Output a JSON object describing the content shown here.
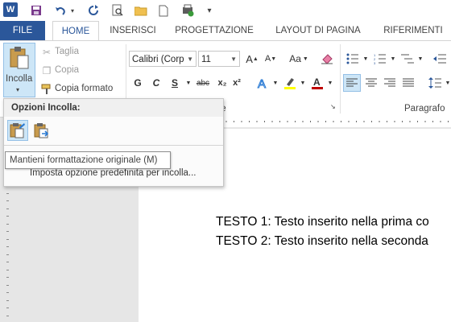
{
  "qat": {
    "icons": [
      "word-logo-icon",
      "save-icon",
      "undo-icon",
      "redo-icon",
      "print-preview-icon",
      "open-folder-icon",
      "new-document-icon",
      "send-icon",
      "customize-icon"
    ],
    "word_logo": "W"
  },
  "tabs": [
    {
      "label": "FILE"
    },
    {
      "label": "HOME"
    },
    {
      "label": "INSERISCI"
    },
    {
      "label": "PROGETTAZIONE"
    },
    {
      "label": "LAYOUT DI PAGINA"
    },
    {
      "label": "RIFERIMENTI"
    }
  ],
  "clipboard": {
    "paste_label": "Incolla",
    "cut_label": "Taglia",
    "copy_label": "Copia",
    "format_painter_label": "Copia formato"
  },
  "font": {
    "name": "Calibri (Corp",
    "size": "11",
    "group_label": "atttere",
    "bold": "G",
    "italic": "C",
    "underline": "S",
    "strike": "abc",
    "subscript": "x₂",
    "superscript": "x²",
    "grow": "A",
    "shrink": "A",
    "case": "Aa",
    "highlight_color": "#ffff00",
    "font_color": "#c00000"
  },
  "paragraph": {
    "group_label": "Paragrafo"
  },
  "paste_menu": {
    "header": "Opzioni Incolla:",
    "set_default": "Imposta opzione predefinita per incolla..."
  },
  "tooltip": {
    "text": "Mantieni formattazione originale (M)"
  },
  "document": {
    "line1": "TESTO 1: Testo inserito nella prima co",
    "line2": "TESTO 2: Testo inserito nella seconda"
  },
  "colors": {
    "accent": "#2b579a",
    "selection": "#cde6f7"
  }
}
